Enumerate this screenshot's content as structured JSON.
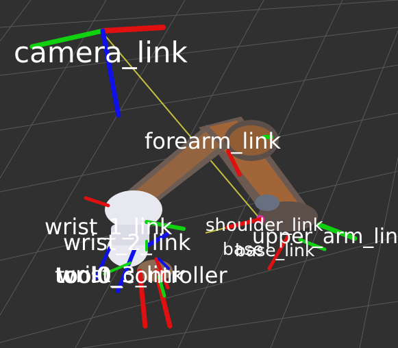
{
  "viewer": {
    "background": "#303030",
    "grid_color": "#7a7a7a",
    "axis_colors": {
      "x": "#e01010",
      "y": "#10d010",
      "z": "#1010e8"
    },
    "link_line_color": "#c8c040",
    "robot_color": "#6a5a52",
    "robot_accent_color": "#d07020",
    "gripper_color": "#e8e8f0"
  },
  "frames": {
    "camera_link": "camera_link",
    "forearm_link": "forearm_link",
    "upper_arm_link": "upper_arm_link",
    "shoulder_link": "shoulder_link",
    "base_link": "base_link",
    "base": "base",
    "wrist_1_link": "wrist_1_link",
    "wrist_2_link": "wrist_2_link",
    "wrist_3_link": "wrist_3_link",
    "tool0": "tool0",
    "tool0_controller": "tool0_controller"
  }
}
